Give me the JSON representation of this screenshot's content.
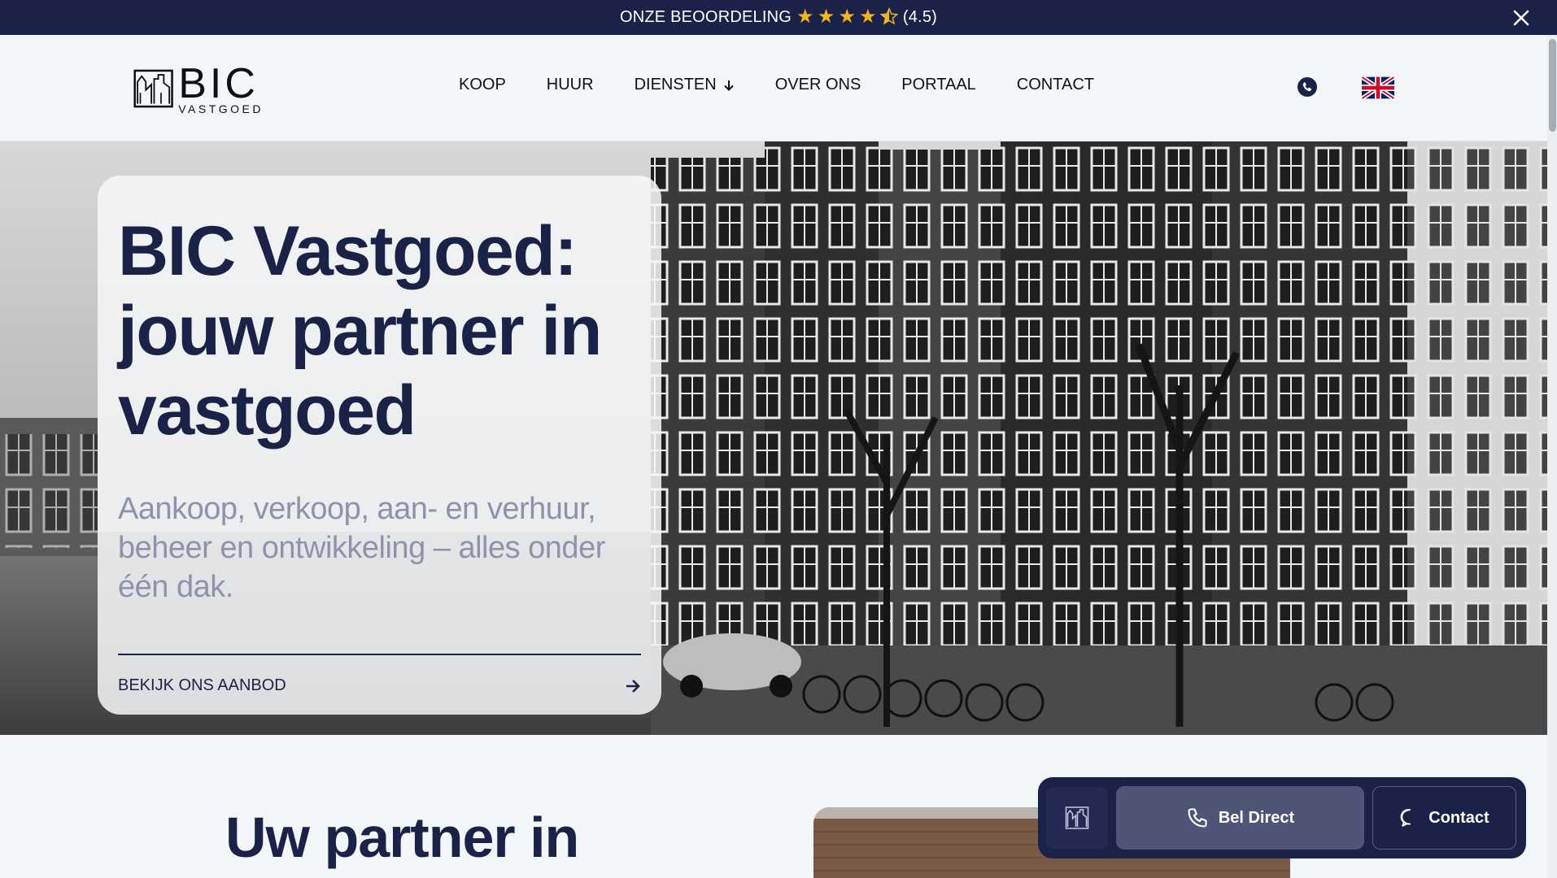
{
  "announcement": {
    "text": "ONZE BEOORDELING",
    "rating": "(4.5)",
    "stars_filled": 4.5,
    "stars_total": 5
  },
  "brand": {
    "logo_main": "BIC",
    "logo_sub": "VASTGOED",
    "primary_color": "#1b2248",
    "star_color": "#f3b51c"
  },
  "nav": {
    "items": [
      {
        "label": "KOOP"
      },
      {
        "label": "HUUR"
      },
      {
        "label": "DIENSTEN"
      },
      {
        "label": "OVER ONS"
      },
      {
        "label": "PORTAAL"
      },
      {
        "label": "CONTACT"
      }
    ]
  },
  "icons": {
    "phone": "phone-icon",
    "language": "uk-flag-icon",
    "close": "close-icon",
    "arrow": "arrow-right-icon",
    "chevron": "chevron-down-icon"
  },
  "hero": {
    "title": "BIC Vastgoed: jouw partner in vastgoed",
    "subtitle": "Aankoop, verkoop, aan- en verhuur, beheer en ontwikkeling – alles onder één dak.",
    "cta": "BEKIJK ONS AANBOD"
  },
  "section": {
    "title": "Uw partner in"
  },
  "float_bar": {
    "call_label": "Bel Direct",
    "contact_label": "Contact"
  }
}
